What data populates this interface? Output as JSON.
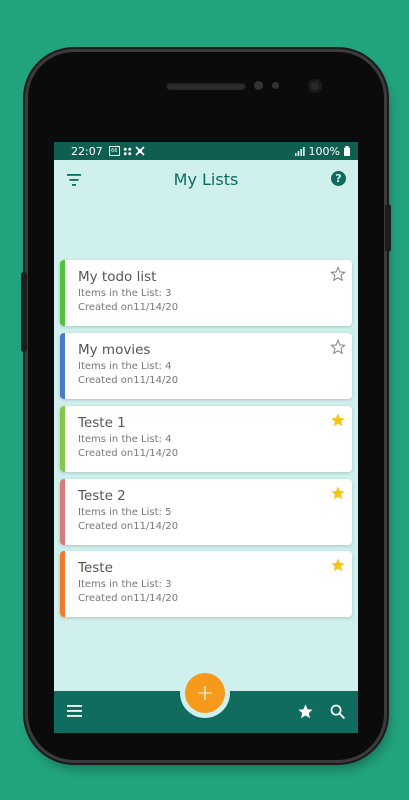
{
  "statusbar": {
    "time": "22:07",
    "battery": "100%"
  },
  "appbar": {
    "title": "My Lists"
  },
  "colors": {
    "appbar_text": "#0d6b5d",
    "bottom_bar": "#0f6c5e",
    "fab": "#f59a1b",
    "star_on": "#f5c518"
  },
  "lists": [
    {
      "title": "My todo list",
      "count": "Items in the List:  3",
      "created": "Created on11/14/20",
      "accent": "#4fc13b",
      "favorite": false
    },
    {
      "title": "My movies",
      "count": "Items in the List:  4",
      "created": "Created on11/14/20",
      "accent": "#4a7bc6",
      "favorite": false
    },
    {
      "title": "Teste 1",
      "count": "Items in the List:  4",
      "created": "Created on11/14/20",
      "accent": "#86c64d",
      "favorite": true
    },
    {
      "title": "Teste 2",
      "count": "Items in the List:  5",
      "created": "Created on11/14/20",
      "accent": "#d77a7a",
      "favorite": true
    },
    {
      "title": "Teste",
      "count": "Items in the List:  3",
      "created": "Created on11/14/20",
      "accent": "#ee7b2b",
      "favorite": true
    }
  ],
  "fab": {
    "label": "+"
  },
  "icons": {
    "filter": "filter-icon",
    "help": "help-icon",
    "menu": "menu-icon",
    "favorites": "star-icon",
    "search": "search-icon",
    "add": "plus-icon"
  }
}
